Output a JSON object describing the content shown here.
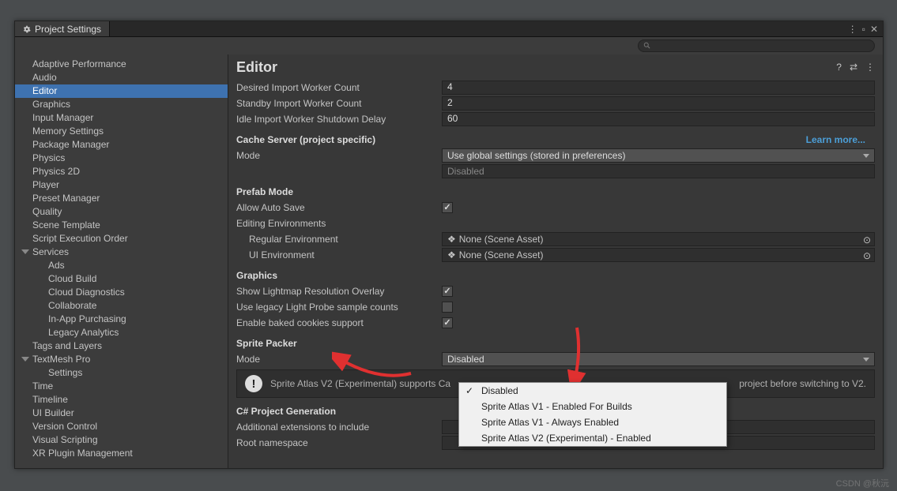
{
  "window_title": "Project Settings",
  "search_placeholder": "",
  "sidebar": {
    "items": [
      {
        "label": "Adaptive Performance"
      },
      {
        "label": "Audio"
      },
      {
        "label": "Editor",
        "selected": true
      },
      {
        "label": "Graphics"
      },
      {
        "label": "Input Manager"
      },
      {
        "label": "Memory Settings"
      },
      {
        "label": "Package Manager"
      },
      {
        "label": "Physics"
      },
      {
        "label": "Physics 2D"
      },
      {
        "label": "Player"
      },
      {
        "label": "Preset Manager"
      },
      {
        "label": "Quality"
      },
      {
        "label": "Scene Template"
      },
      {
        "label": "Script Execution Order"
      },
      {
        "label": "Services",
        "expand": true
      },
      {
        "label": "Ads",
        "child": true
      },
      {
        "label": "Cloud Build",
        "child": true
      },
      {
        "label": "Cloud Diagnostics",
        "child": true
      },
      {
        "label": "Collaborate",
        "child": true
      },
      {
        "label": "In-App Purchasing",
        "child": true
      },
      {
        "label": "Legacy Analytics",
        "child": true
      },
      {
        "label": "Tags and Layers"
      },
      {
        "label": "TextMesh Pro",
        "expand": true
      },
      {
        "label": "Settings",
        "child": true
      },
      {
        "label": "Time"
      },
      {
        "label": "Timeline"
      },
      {
        "label": "UI Builder"
      },
      {
        "label": "Version Control"
      },
      {
        "label": "Visual Scripting"
      },
      {
        "label": "XR Plugin Management"
      }
    ]
  },
  "content": {
    "title": "Editor",
    "desired_import_label": "Desired Import Worker Count",
    "desired_import_value": "4",
    "standby_import_label": "Standby Import Worker Count",
    "standby_import_value": "2",
    "idle_import_label": "Idle Import Worker Shutdown Delay",
    "idle_import_value": "60",
    "cache_server_header": "Cache Server (project specific)",
    "learn_more": "Learn more...",
    "cache_mode_label": "Mode",
    "cache_mode_value": "Use global settings (stored in preferences)",
    "cache_disabled": "Disabled",
    "prefab_header": "Prefab Mode",
    "allow_auto_save_label": "Allow Auto Save",
    "editing_env_label": "Editing Environments",
    "regular_env_label": "Regular Environment",
    "regular_env_value": "None (Scene Asset)",
    "ui_env_label": "UI Environment",
    "ui_env_value": "None (Scene Asset)",
    "graphics_header": "Graphics",
    "show_lightmap_label": "Show Lightmap Resolution Overlay",
    "legacy_light_label": "Use legacy Light Probe sample counts",
    "baked_cookies_label": "Enable baked cookies support",
    "sprite_packer_header": "Sprite Packer",
    "sprite_mode_label": "Mode",
    "sprite_mode_value": "Disabled",
    "sprite_info_prefix": "Sprite Atlas V2 (Experimental) supports Ca",
    "sprite_info_suffix": " project before switching to V2.",
    "csharp_header": "C# Project Generation",
    "additional_ext_label": "Additional extensions to include",
    "root_namespace_label": "Root namespace"
  },
  "popup": {
    "items": [
      {
        "label": "Disabled",
        "checked": true
      },
      {
        "label": "Sprite Atlas V1 - Enabled For Builds"
      },
      {
        "label": "Sprite Atlas V1 - Always Enabled"
      },
      {
        "label": "Sprite Atlas V2 (Experimental) - Enabled"
      }
    ]
  },
  "watermark": "CSDN @秋沅"
}
